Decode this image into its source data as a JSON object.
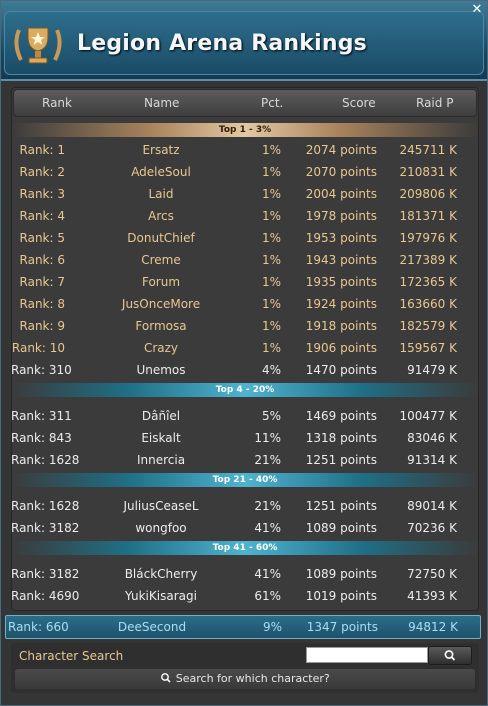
{
  "window": {
    "title": "Legion Arena Rankings",
    "close_label": "✕"
  },
  "columns": {
    "rank": "Rank",
    "name": "Name",
    "pct": "Pct.",
    "score": "Score",
    "raid": "Raid P"
  },
  "groups": [
    {
      "label": "Top 1 - 3%",
      "style": "gold",
      "rows": [
        {
          "rank": "Rank: 1",
          "name": "Ersatz",
          "pct": "1%",
          "score": "2074 points",
          "raid": "245711 K",
          "top": true
        },
        {
          "rank": "Rank: 2",
          "name": "AdeleSoul",
          "pct": "1%",
          "score": "2070 points",
          "raid": "210831 K",
          "top": true
        },
        {
          "rank": "Rank: 3",
          "name": "Laid",
          "pct": "1%",
          "score": "2004 points",
          "raid": "209806 K",
          "top": true
        },
        {
          "rank": "Rank: 4",
          "name": "Arcs",
          "pct": "1%",
          "score": "1978 points",
          "raid": "181371 K",
          "top": true
        },
        {
          "rank": "Rank: 5",
          "name": "DonutChief",
          "pct": "1%",
          "score": "1953 points",
          "raid": "197976 K",
          "top": true
        },
        {
          "rank": "Rank: 6",
          "name": "Creme",
          "pct": "1%",
          "score": "1943 points",
          "raid": "217389 K",
          "top": true
        },
        {
          "rank": "Rank: 7",
          "name": "Forum",
          "pct": "1%",
          "score": "1935 points",
          "raid": "172365 K",
          "top": true
        },
        {
          "rank": "Rank: 8",
          "name": "JusOnceMore",
          "pct": "1%",
          "score": "1924 points",
          "raid": "163660 K",
          "top": true
        },
        {
          "rank": "Rank: 9",
          "name": "Formosa",
          "pct": "1%",
          "score": "1918 points",
          "raid": "182579 K",
          "top": true
        },
        {
          "rank": "Rank: 10",
          "name": "Crazy",
          "pct": "1%",
          "score": "1906 points",
          "raid": "159567 K",
          "top": true
        },
        {
          "rank": "Rank: 310",
          "name": "Unemos",
          "pct": "4%",
          "score": "1470 points",
          "raid": "91479 K",
          "top": false
        }
      ]
    },
    {
      "label": "Top 4 - 20%",
      "style": "blue",
      "rows": [
        {
          "rank": "Rank: 311",
          "name": "Dâñîel",
          "pct": "5%",
          "score": "1469 points",
          "raid": "100477 K",
          "top": false
        },
        {
          "rank": "Rank: 843",
          "name": "Eiskalt",
          "pct": "11%",
          "score": "1318 points",
          "raid": "83046 K",
          "top": false
        },
        {
          "rank": "Rank: 1628",
          "name": "Innercia",
          "pct": "21%",
          "score": "1251 points",
          "raid": "91314 K",
          "top": false
        }
      ]
    },
    {
      "label": "Top 21 - 40%",
      "style": "blue",
      "rows": [
        {
          "rank": "Rank: 1628",
          "name": "JuliusCeaseL",
          "pct": "21%",
          "score": "1251 points",
          "raid": "89014 K",
          "top": false
        },
        {
          "rank": "Rank: 3182",
          "name": "wongfoo",
          "pct": "41%",
          "score": "1089 points",
          "raid": "70236 K",
          "top": false
        }
      ]
    },
    {
      "label": "Top 41 - 60%",
      "style": "blue",
      "rows": [
        {
          "rank": "Rank: 3182",
          "name": "BláckCherry",
          "pct": "41%",
          "score": "1089 points",
          "raid": "72750 K",
          "top": false
        },
        {
          "rank": "Rank: 4690",
          "name": "YukiKisaragi",
          "pct": "61%",
          "score": "1019 points",
          "raid": "41393 K",
          "top": false
        }
      ]
    }
  ],
  "my_rank": {
    "rank": "Rank: 660",
    "name": "DeeSecond",
    "pct": "9%",
    "score": "1347 points",
    "raid": "94812 K"
  },
  "search": {
    "label": "Character Search",
    "input_value": "",
    "hint": "Search for which character?",
    "icon": "search-icon"
  },
  "colors": {
    "accent_gold": "#e9c78f",
    "accent_blue": "#4fb3cf",
    "highlight_text": "#9fe1f4"
  }
}
